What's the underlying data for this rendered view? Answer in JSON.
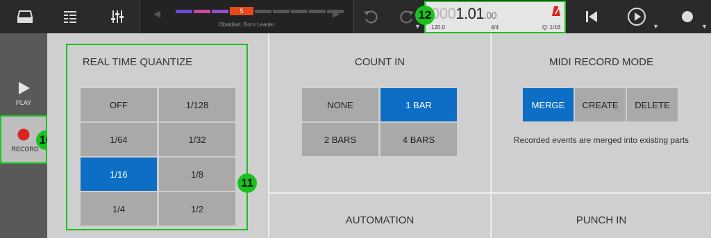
{
  "topbar": {
    "song": {
      "current_part": "5",
      "name": "Obsidian: Born Leader"
    },
    "counter": {
      "leading_zeros": "000",
      "position": "1.01",
      "ticks": ".00",
      "tempo": "120.0",
      "time_signature": "4/4",
      "quantize": "Q: 1/16"
    }
  },
  "badges": {
    "record": "10",
    "quantize_panel": "11",
    "counter": "12"
  },
  "left_rail": {
    "play_label": "PLAY",
    "record_label": "RECORD"
  },
  "quantize": {
    "title": "REAL TIME QUANTIZE",
    "options": [
      "OFF",
      "1/128",
      "1/64",
      "1/32",
      "1/16",
      "1/8",
      "1/4",
      "1/2"
    ],
    "selected": "1/16"
  },
  "count_in": {
    "title": "COUNT IN",
    "options": [
      "NONE",
      "1 BAR",
      "2 BARS",
      "4 BARS"
    ],
    "selected": "1 BAR"
  },
  "midi_record_mode": {
    "title": "MIDI RECORD MODE",
    "options": [
      "MERGE",
      "CREATE",
      "DELETE"
    ],
    "selected": "MERGE",
    "description": "Recorded events are merged into existing parts"
  },
  "automation": {
    "title": "AUTOMATION"
  },
  "punch_in": {
    "title": "PUNCH IN"
  },
  "colors": {
    "accent_blue": "#0d6ec6",
    "highlight_green": "#19c21e",
    "record_red": "#d8261f",
    "part_orange": "#e54b1a"
  }
}
